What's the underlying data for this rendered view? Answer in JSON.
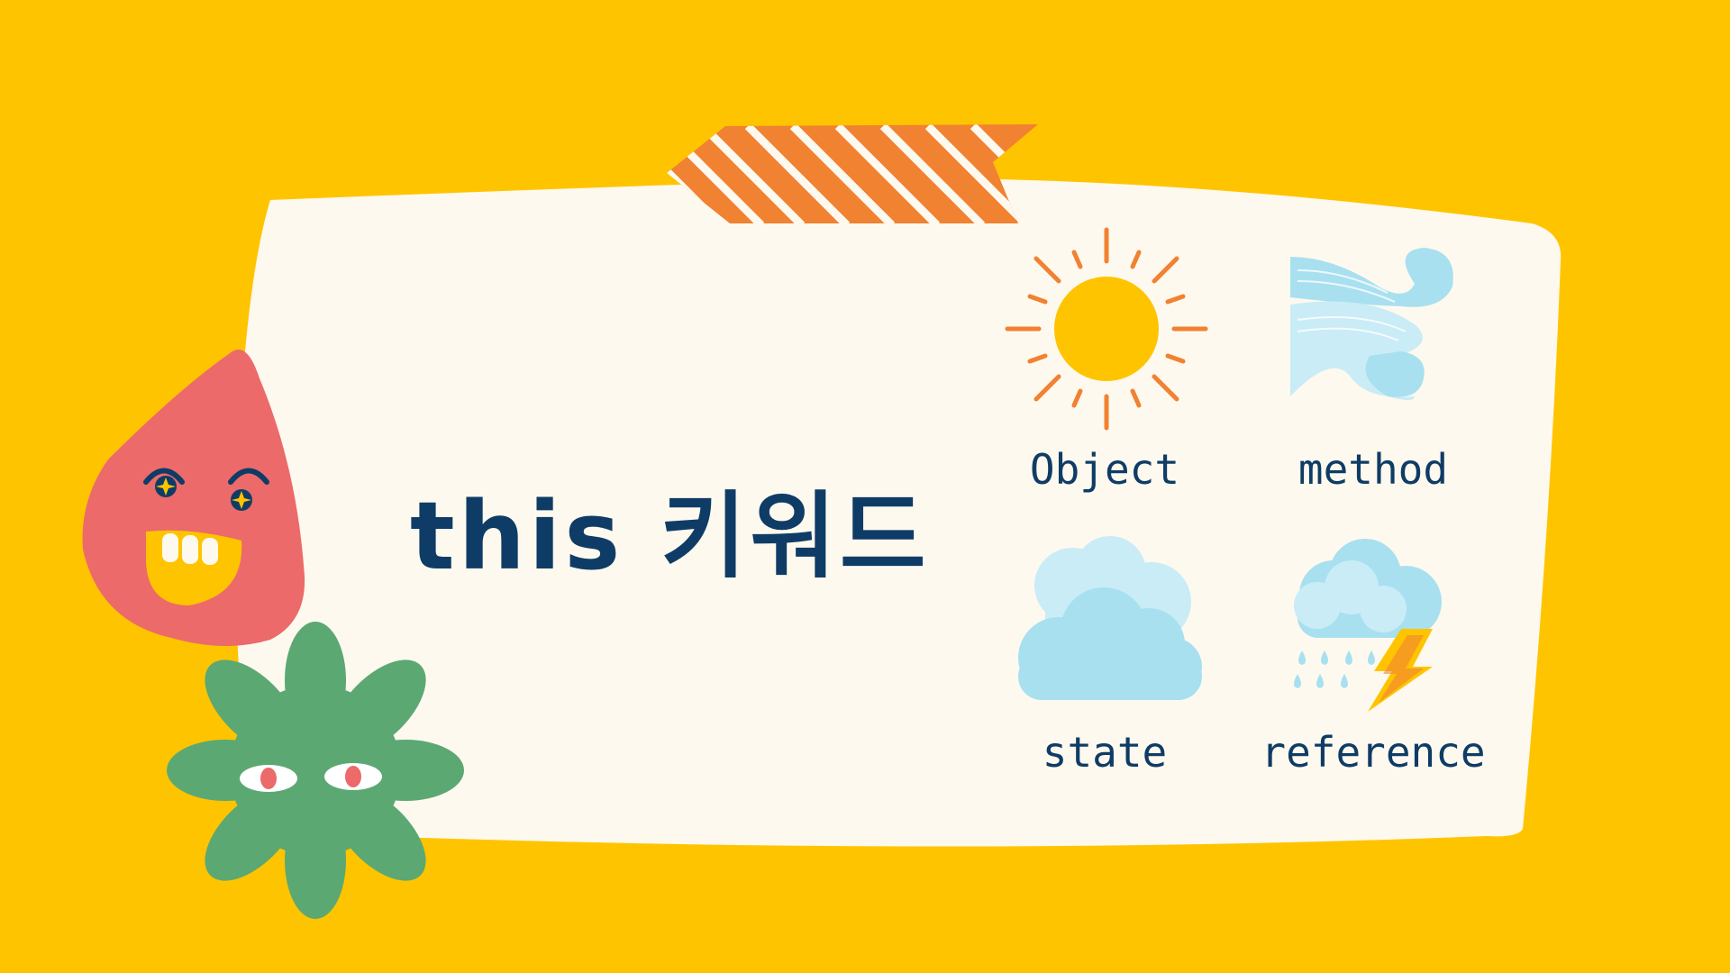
{
  "slide": {
    "title": "this 키워드",
    "colors": {
      "background": "#FFC400",
      "paper": "#FEF9EE",
      "text": "#0F3C66",
      "tape": "#F08232",
      "drop_character": "#EC6A6A",
      "flower_character": "#5BA873",
      "sun": "#FFC400",
      "sun_rays": "#F08232",
      "cloud": "#A8E0F0"
    },
    "icons": [
      {
        "icon": "sun-icon",
        "label": "Object"
      },
      {
        "icon": "wind-icon",
        "label": "method"
      },
      {
        "icon": "cloud-icon",
        "label": "state"
      },
      {
        "icon": "storm-icon",
        "label": "reference"
      }
    ]
  }
}
